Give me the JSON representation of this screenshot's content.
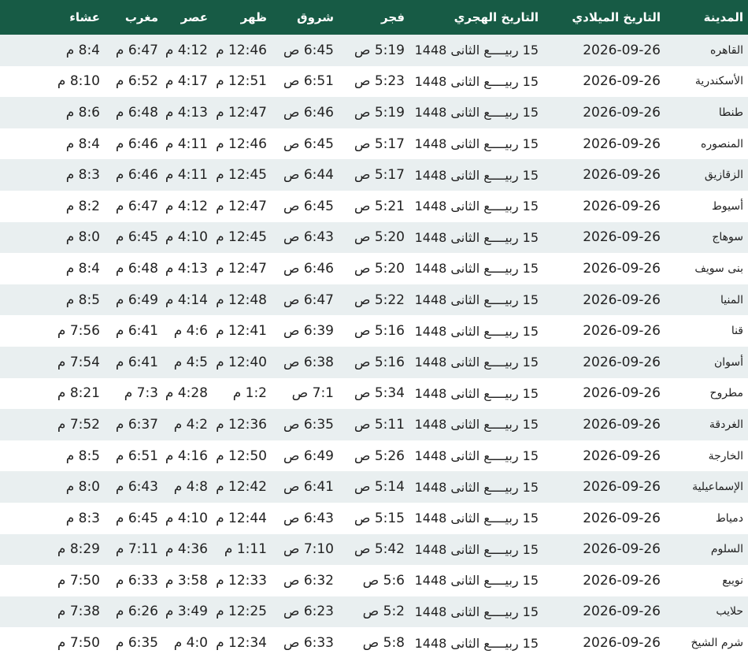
{
  "table": {
    "headers": {
      "city": "المدينة",
      "gregorian": "التاريخ الميلادي",
      "hijri": "التاريخ الهجري",
      "fajr": "فجر",
      "shuruq": "شروق",
      "dhuhr": "ظهر",
      "asr": "عصر",
      "maghrib": "مغرب",
      "isha": "عشاء"
    },
    "rows": [
      {
        "city": "القاهره",
        "gregorian": "2026-09-26",
        "hijri": "15 ربيــــع الثانى 1448",
        "fajr": "5:19 ص",
        "shuruq": "6:45 ص",
        "dhuhr": "12:46 م",
        "asr": "4:12 م",
        "maghrib": "6:47 م",
        "isha": "8:4 م"
      },
      {
        "city": "الأسكندرية",
        "gregorian": "2026-09-26",
        "hijri": "15 ربيــــع الثانى 1448",
        "fajr": "5:23 ص",
        "shuruq": "6:51 ص",
        "dhuhr": "12:51 م",
        "asr": "4:17 م",
        "maghrib": "6:52 م",
        "isha": "8:10 م"
      },
      {
        "city": "طنطا",
        "gregorian": "2026-09-26",
        "hijri": "15 ربيــــع الثانى 1448",
        "fajr": "5:19 ص",
        "shuruq": "6:46 ص",
        "dhuhr": "12:47 م",
        "asr": "4:13 م",
        "maghrib": "6:48 م",
        "isha": "8:6 م"
      },
      {
        "city": "المنصوره",
        "gregorian": "2026-09-26",
        "hijri": "15 ربيــــع الثانى 1448",
        "fajr": "5:17 ص",
        "shuruq": "6:45 ص",
        "dhuhr": "12:46 م",
        "asr": "4:11 م",
        "maghrib": "6:46 م",
        "isha": "8:4 م"
      },
      {
        "city": "الزقازيق",
        "gregorian": "2026-09-26",
        "hijri": "15 ربيــــع الثانى 1448",
        "fajr": "5:17 ص",
        "shuruq": "6:44 ص",
        "dhuhr": "12:45 م",
        "asr": "4:11 م",
        "maghrib": "6:46 م",
        "isha": "8:3 م"
      },
      {
        "city": "أسيوط",
        "gregorian": "2026-09-26",
        "hijri": "15 ربيــــع الثانى 1448",
        "fajr": "5:21 ص",
        "shuruq": "6:45 ص",
        "dhuhr": "12:47 م",
        "asr": "4:12 م",
        "maghrib": "6:47 م",
        "isha": "8:2 م"
      },
      {
        "city": "سوهاج",
        "gregorian": "2026-09-26",
        "hijri": "15 ربيــــع الثانى 1448",
        "fajr": "5:20 ص",
        "shuruq": "6:43 ص",
        "dhuhr": "12:45 م",
        "asr": "4:10 م",
        "maghrib": "6:45 م",
        "isha": "8:0 م"
      },
      {
        "city": "بنى سويف",
        "gregorian": "2026-09-26",
        "hijri": "15 ربيــــع الثانى 1448",
        "fajr": "5:20 ص",
        "shuruq": "6:46 ص",
        "dhuhr": "12:47 م",
        "asr": "4:13 م",
        "maghrib": "6:48 م",
        "isha": "8:4 م"
      },
      {
        "city": "المنيا",
        "gregorian": "2026-09-26",
        "hijri": "15 ربيــــع الثانى 1448",
        "fajr": "5:22 ص",
        "shuruq": "6:47 ص",
        "dhuhr": "12:48 م",
        "asr": "4:14 م",
        "maghrib": "6:49 م",
        "isha": "8:5 م"
      },
      {
        "city": "قنا",
        "gregorian": "2026-09-26",
        "hijri": "15 ربيــــع الثانى 1448",
        "fajr": "5:16 ص",
        "shuruq": "6:39 ص",
        "dhuhr": "12:41 م",
        "asr": "4:6 م",
        "maghrib": "6:41 م",
        "isha": "7:56 م"
      },
      {
        "city": "أسوان",
        "gregorian": "2026-09-26",
        "hijri": "15 ربيــــع الثانى 1448",
        "fajr": "5:16 ص",
        "shuruq": "6:38 ص",
        "dhuhr": "12:40 م",
        "asr": "4:5 م",
        "maghrib": "6:41 م",
        "isha": "7:54 م"
      },
      {
        "city": "مطروح",
        "gregorian": "2026-09-26",
        "hijri": "15 ربيــــع الثانى 1448",
        "fajr": "5:34 ص",
        "shuruq": "7:1 ص",
        "dhuhr": "1:2 م",
        "asr": "4:28 م",
        "maghrib": "7:3 م",
        "isha": "8:21 م"
      },
      {
        "city": "الغردقة",
        "gregorian": "2026-09-26",
        "hijri": "15 ربيــــع الثانى 1448",
        "fajr": "5:11 ص",
        "shuruq": "6:35 ص",
        "dhuhr": "12:36 م",
        "asr": "4:2 م",
        "maghrib": "6:37 م",
        "isha": "7:52 م"
      },
      {
        "city": "الخارجة",
        "gregorian": "2026-09-26",
        "hijri": "15 ربيــــع الثانى 1448",
        "fajr": "5:26 ص",
        "shuruq": "6:49 ص",
        "dhuhr": "12:50 م",
        "asr": "4:16 م",
        "maghrib": "6:51 م",
        "isha": "8:5 م"
      },
      {
        "city": "الإسماعيلية",
        "gregorian": "2026-09-26",
        "hijri": "15 ربيــــع الثانى 1448",
        "fajr": "5:14 ص",
        "shuruq": "6:41 ص",
        "dhuhr": "12:42 م",
        "asr": "4:8 م",
        "maghrib": "6:43 م",
        "isha": "8:0 م"
      },
      {
        "city": "دمياط",
        "gregorian": "2026-09-26",
        "hijri": "15 ربيــــع الثانى 1448",
        "fajr": "5:15 ص",
        "shuruq": "6:43 ص",
        "dhuhr": "12:44 م",
        "asr": "4:10 م",
        "maghrib": "6:45 م",
        "isha": "8:3 م"
      },
      {
        "city": "السلوم",
        "gregorian": "2026-09-26",
        "hijri": "15 ربيــــع الثانى 1448",
        "fajr": "5:42 ص",
        "shuruq": "7:10 ص",
        "dhuhr": "1:11 م",
        "asr": "4:36 م",
        "maghrib": "7:11 م",
        "isha": "8:29 م"
      },
      {
        "city": "نويبع",
        "gregorian": "2026-09-26",
        "hijri": "15 ربيــــع الثانى 1448",
        "fajr": "5:6 ص",
        "shuruq": "6:32 ص",
        "dhuhr": "12:33 م",
        "asr": "3:58 م",
        "maghrib": "6:33 م",
        "isha": "7:50 م"
      },
      {
        "city": "حلايب",
        "gregorian": "2026-09-26",
        "hijri": "15 ربيــــع الثانى 1448",
        "fajr": "5:2 ص",
        "shuruq": "6:23 ص",
        "dhuhr": "12:25 م",
        "asr": "3:49 م",
        "maghrib": "6:26 م",
        "isha": "7:38 م"
      },
      {
        "city": "شرم الشيخ",
        "gregorian": "2026-09-26",
        "hijri": "15 ربيــــع الثانى 1448",
        "fajr": "5:8 ص",
        "shuruq": "6:33 ص",
        "dhuhr": "12:34 م",
        "asr": "4:0 م",
        "maghrib": "6:35 م",
        "isha": "7:50 م"
      }
    ]
  },
  "colors": {
    "header_bg": "#175b45",
    "header_text": "#ffffff",
    "row_odd": "#e9eff0",
    "row_even": "#ffffff"
  }
}
